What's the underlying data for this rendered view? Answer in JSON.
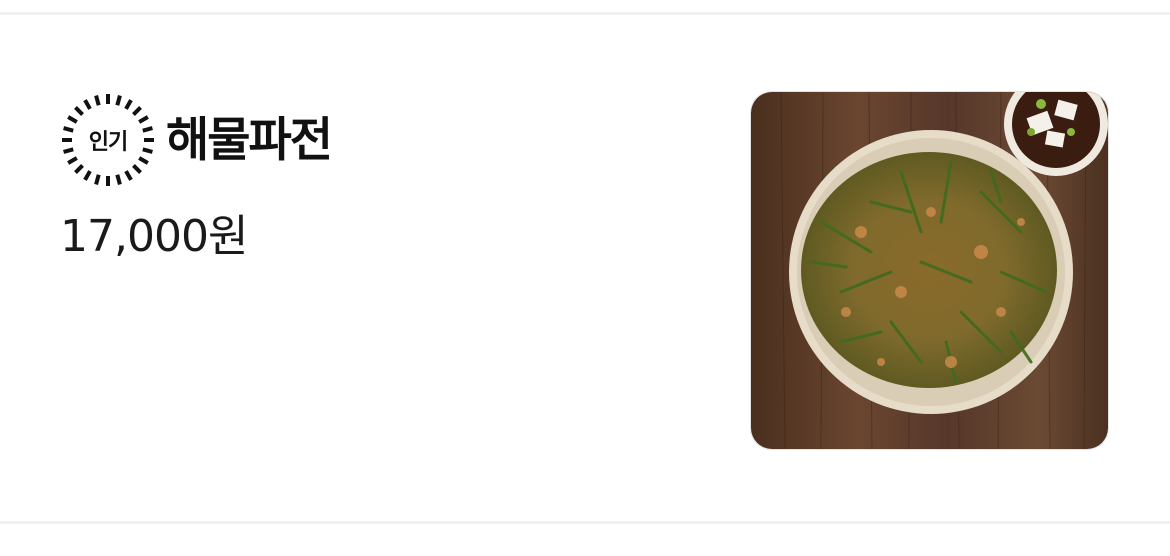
{
  "menu_item": {
    "badge": "인기",
    "name": "해물파전",
    "price": "17,000원",
    "photo_icon": "seafood-pancake-photo"
  },
  "colors": {
    "text": "#111111",
    "divider": "#f0f0f0",
    "wood": "#5a3a25",
    "plate": "#e8dfcf",
    "pancake": "#9a7a2e",
    "greens": "#3f6b1e"
  }
}
